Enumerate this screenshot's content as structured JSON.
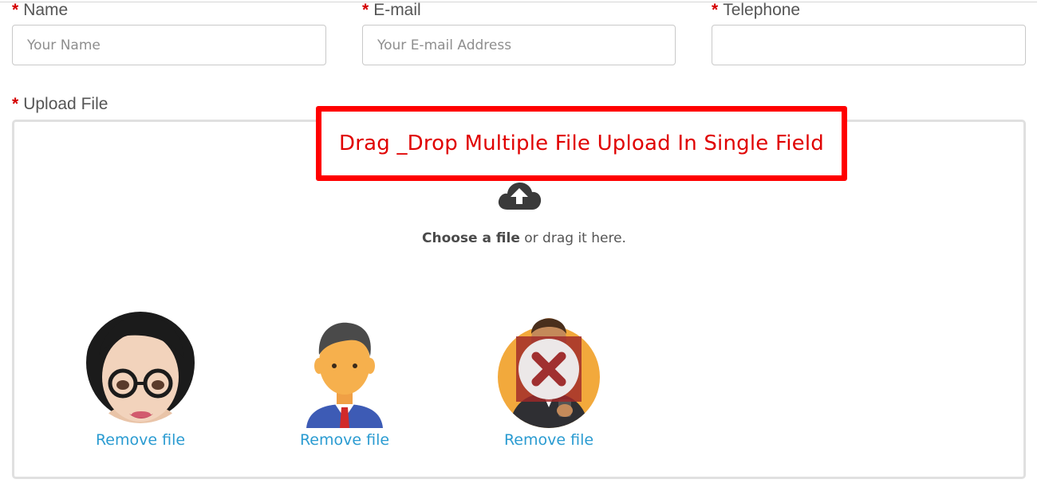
{
  "form": {
    "name": {
      "required_mark": "*",
      "label": "Name",
      "placeholder": "Your Name",
      "value": ""
    },
    "email": {
      "required_mark": "*",
      "label": "E-mail",
      "placeholder": "Your E-mail Address",
      "value": ""
    },
    "telephone": {
      "required_mark": "*",
      "label": "Telephone",
      "placeholder": "",
      "value": ""
    }
  },
  "upload": {
    "required_mark": "*",
    "label": "Upload File",
    "choose_bold": "Choose a file",
    "choose_rest": " or drag it here.",
    "icon": "cloud-upload-icon"
  },
  "banner": {
    "text": "Drag _Drop Multiple File Upload In Single Field",
    "color": "#ff0000"
  },
  "previews": [
    {
      "avatar": "woman-avatar",
      "remove_label": "Remove file",
      "status": "ok"
    },
    {
      "avatar": "man-avatar",
      "remove_label": "Remove file",
      "status": "ok"
    },
    {
      "avatar": "businessman-avatar",
      "remove_label": "Remove file",
      "status": "error",
      "error_icon": "error-x-icon"
    }
  ],
  "colors": {
    "required": "#d40000",
    "link": "#2a9bd1",
    "border": "#e0e0e0"
  }
}
